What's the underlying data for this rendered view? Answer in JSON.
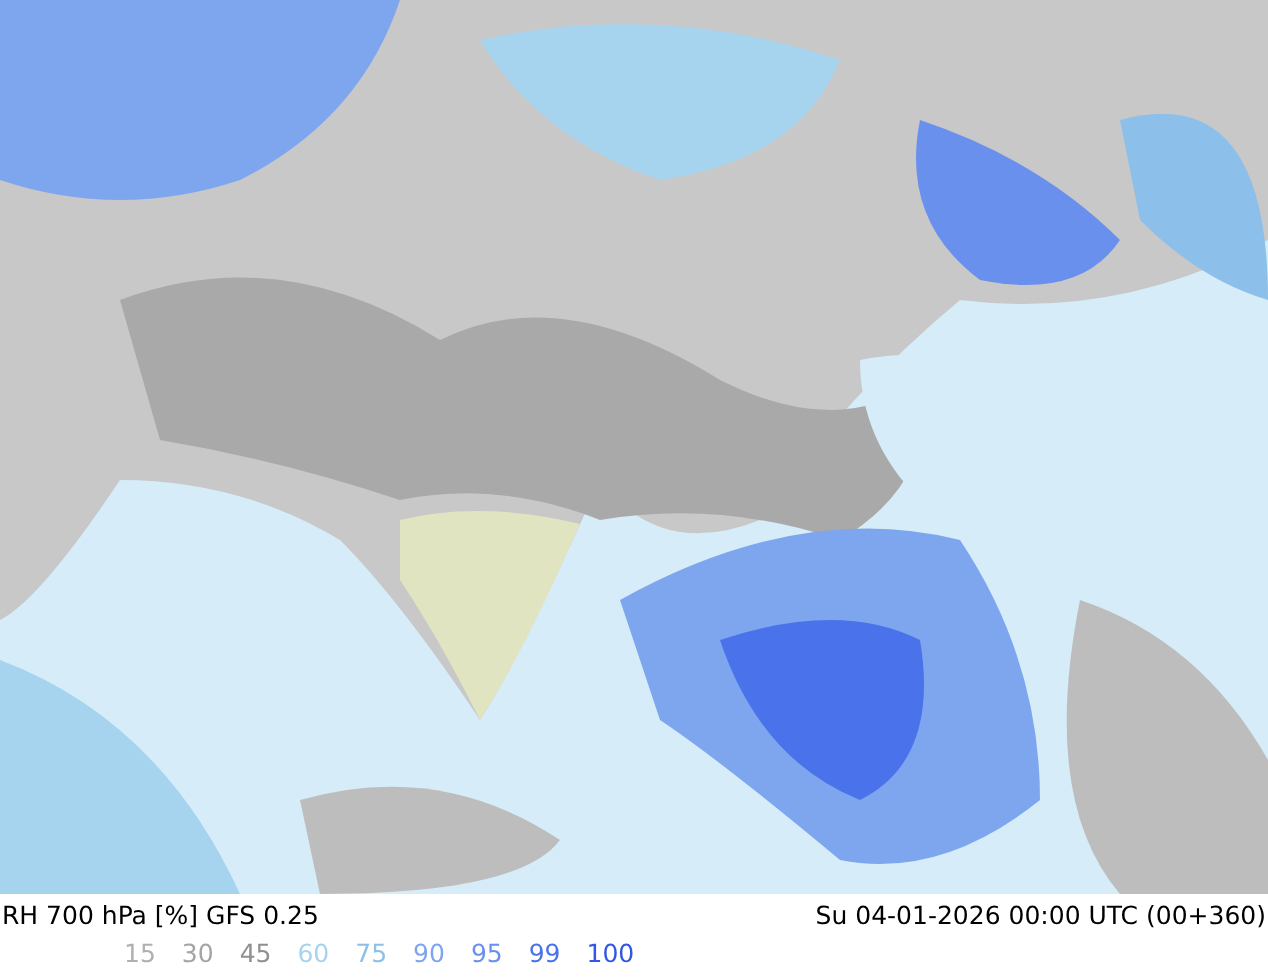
{
  "title": "RH 700 hPa [%] GFS 0.25",
  "valid_time": "Su 04-01-2026 00:00 UTC (00+360)",
  "legend": [
    {
      "label": "15",
      "color": "#b0b0b0"
    },
    {
      "label": "30",
      "color": "#a4a4a4"
    },
    {
      "label": "45",
      "color": "#909090"
    },
    {
      "label": "60",
      "color": "#a6d4ee"
    },
    {
      "label": "75",
      "color": "#8cc0ea"
    },
    {
      "label": "90",
      "color": "#7ea6ee"
    },
    {
      "label": "95",
      "color": "#6a90ee"
    },
    {
      "label": "99",
      "color": "#4a72ea"
    },
    {
      "label": "100",
      "color": "#3456e4"
    }
  ]
}
